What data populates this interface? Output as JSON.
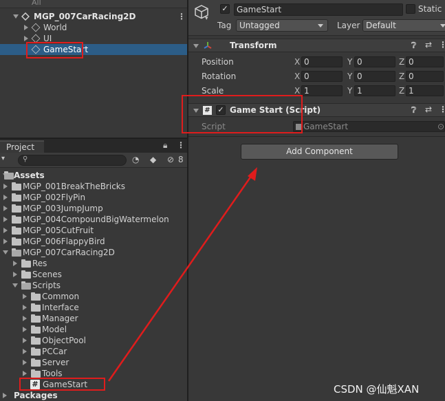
{
  "hierarchy": {
    "search_placeholder": "All",
    "scene_name": "MGP_007CarRacing2D",
    "items": [
      "World",
      "UI",
      "GameStart"
    ]
  },
  "inspector": {
    "object_name": "GameStart",
    "static_label": "Static",
    "tag_label": "Tag",
    "tag_value": "Untagged",
    "layer_label": "Layer",
    "layer_value": "Default",
    "transform": {
      "title": "Transform",
      "rows": [
        {
          "label": "Position",
          "x": "0",
          "y": "0",
          "z": "0"
        },
        {
          "label": "Rotation",
          "x": "0",
          "y": "0",
          "z": "0"
        },
        {
          "label": "Scale",
          "x": "1",
          "y": "1",
          "z": "1"
        }
      ],
      "axes": [
        "X",
        "Y",
        "Z"
      ]
    },
    "script_component": {
      "title": "Game Start (Script)",
      "script_label": "Script",
      "script_value": "GameStart"
    },
    "add_component": "Add Component",
    "colors": {
      "redbox": "#e01c1c",
      "selection": "#2c5d87"
    }
  },
  "project": {
    "tab": "Project",
    "hidden_count": "8",
    "assets_label": "Assets",
    "assets": [
      "MGP_001BreakTheBricks",
      "MGP_002FlyPin",
      "MGP_003JumpJump",
      "MGP_004CompoundBigWatermelon",
      "MGP_005CutFruit",
      "MGP_006FlappyBird",
      "MGP_007CarRacing2D"
    ],
    "car_children": [
      "Res",
      "Scenes",
      "Scripts"
    ],
    "script_children": [
      "Common",
      "Interface",
      "Manager",
      "Model",
      "ObjectPool",
      "PCCar",
      "Server",
      "Tools"
    ],
    "script_file": "GameStart",
    "packages_label": "Packages"
  },
  "watermark": "CSDN @仙魁XAN"
}
